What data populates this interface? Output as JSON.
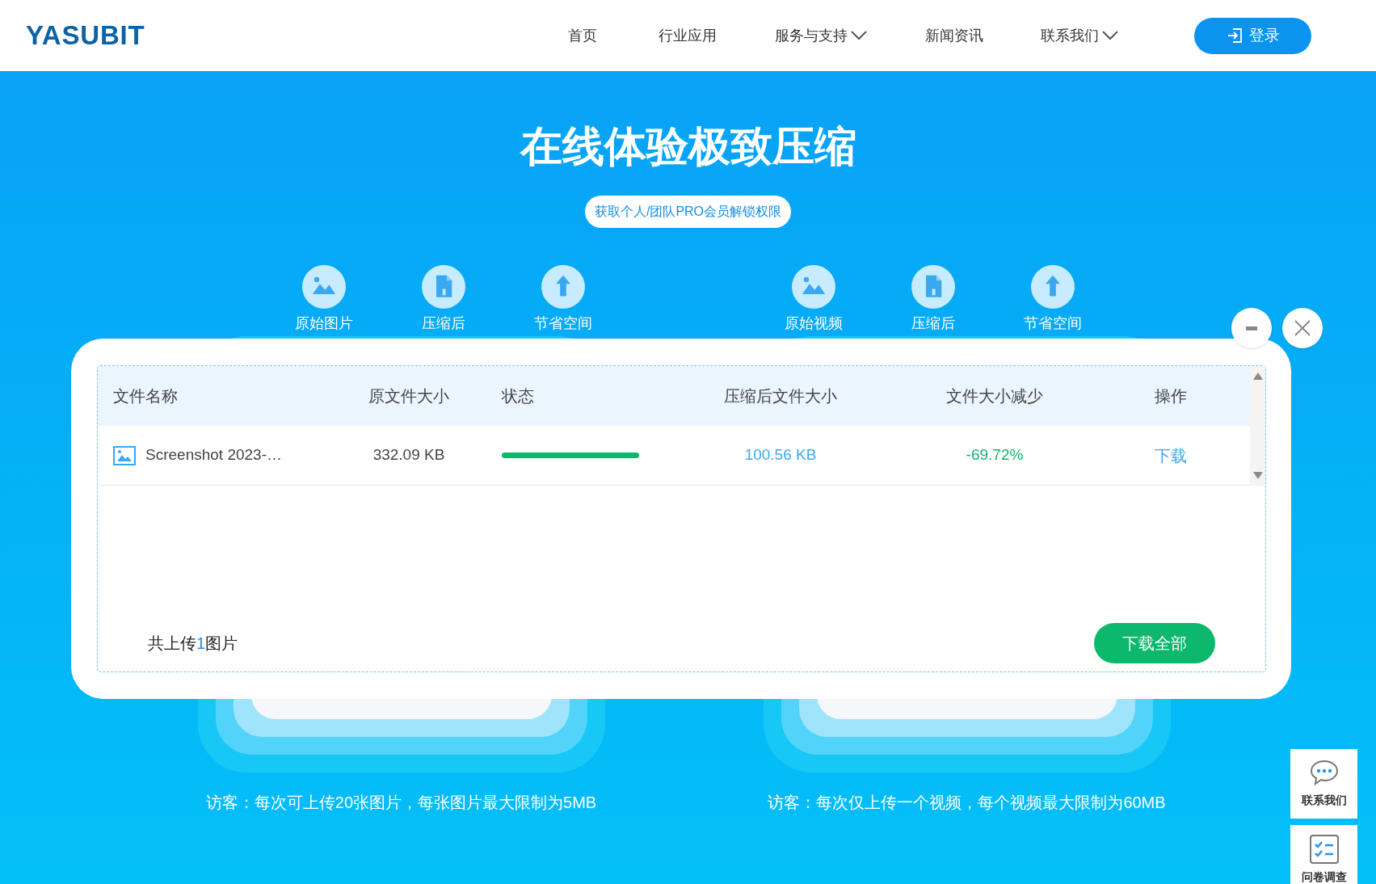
{
  "header": {
    "logo": "YASUBIT",
    "nav": [
      {
        "label": "首页",
        "dropdown": false
      },
      {
        "label": "行业应用",
        "dropdown": false
      },
      {
        "label": "服务与支持",
        "dropdown": true
      },
      {
        "label": "新闻资讯",
        "dropdown": false
      },
      {
        "label": "联系我们",
        "dropdown": true
      }
    ],
    "login": "登录"
  },
  "hero": {
    "title": "在线体验极致压缩",
    "pro_button": "获取个人/团队PRO会员解锁权限"
  },
  "stats": [
    [
      {
        "kind": "image",
        "label": "原始图片"
      },
      {
        "kind": "file",
        "label": "压缩后"
      },
      {
        "kind": "upload",
        "label": "节省空间"
      }
    ],
    [
      {
        "kind": "image",
        "label": "原始视频"
      },
      {
        "kind": "file",
        "label": "压缩后"
      },
      {
        "kind": "upload",
        "label": "节省空间"
      }
    ]
  ],
  "captions": [
    "访客：每次可上传20张图片，每张图片最大限制为5MB",
    "访客：每次仅上传一个视频，每个视频最大限制为60MB"
  ],
  "dialog": {
    "table": {
      "columns": [
        "文件名称",
        "原文件大小",
        "状态",
        "压缩后文件大小",
        "文件大小减少",
        "操作"
      ],
      "rows": [
        {
          "name": "Screenshot 2023-…",
          "size": "332.09 KB",
          "level": 1,
          "compressed": "100.56 KB",
          "reduction": "-69.72%",
          "action": "下载"
        }
      ]
    },
    "footer": {
      "prefix": "共上传",
      "count": "1",
      "suffix": "图片"
    },
    "download_all": "下载全部"
  },
  "side_widgets": [
    {
      "kind": "chat",
      "label": "联系我们"
    },
    {
      "kind": "survey",
      "label": "问卷调查"
    }
  ]
}
